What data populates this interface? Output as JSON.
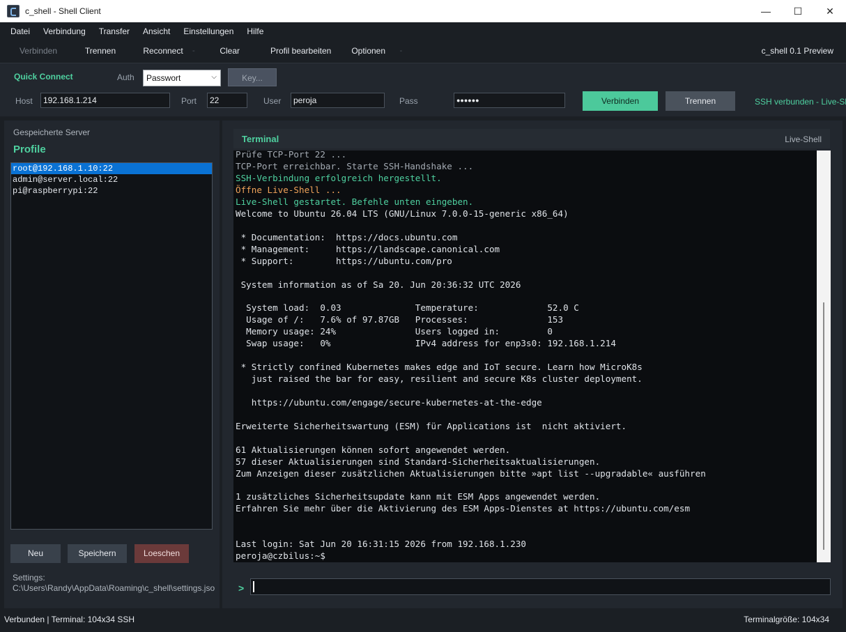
{
  "window": {
    "title": "c_shell - Shell Client",
    "controls": {
      "minimize": "—",
      "maximize": "☐",
      "close": "✕"
    }
  },
  "menu": [
    "Datei",
    "Verbindung",
    "Transfer",
    "Ansicht",
    "Einstellungen",
    "Hilfe"
  ],
  "toolbar": {
    "connect": "Verbinden",
    "disconnect": "Trennen",
    "reconnect": "Reconnect",
    "clear": "Clear",
    "edit_profile": "Profil bearbeiten",
    "options": "Optionen",
    "separator": "-",
    "version": "c_shell 0.1 Preview"
  },
  "quick_connect": {
    "title": "Quick Connect",
    "auth_label": "Auth",
    "auth_value": "Passwort",
    "key_button": "Key...",
    "host_label": "Host",
    "host_value": "192.168.1.214",
    "port_label": "Port",
    "port_value": "22",
    "user_label": "User",
    "user_value": "peroja",
    "pass_label": "Pass",
    "pass_value": "●●●●●●",
    "connect_button": "Verbinden",
    "disconnect_button": "Trennen",
    "status": "SSH verbunden - Live-Shell"
  },
  "sidebar": {
    "caption": "Gespeicherte Server",
    "title": "Profile",
    "profiles": [
      "root@192.168.1.10:22",
      "admin@server.local:22",
      "pi@raspberrypi:22"
    ],
    "selected_index": 0,
    "btn_new": "Neu",
    "btn_save": "Speichern",
    "btn_delete": "Loeschen",
    "settings_label": "Settings:",
    "settings_path": "C:\\Users\\Randy\\AppData\\Roaming\\c_shell\\settings.json"
  },
  "terminal": {
    "title": "Terminal",
    "badge": "Live-Shell",
    "lines": [
      {
        "text": "Prüfe TCP-Port 22 ...",
        "color": "gray"
      },
      {
        "text": "TCP-Port erreichbar. Starte SSH-Handshake ...",
        "color": "gray"
      },
      {
        "text": "SSH-Verbindung erfolgreich hergestellt.",
        "color": "green"
      },
      {
        "text": "Öffne Live-Shell ...",
        "color": "orange"
      },
      {
        "text": "Live-Shell gestartet. Befehle unten eingeben.",
        "color": "green"
      },
      {
        "text": "Welcome to Ubuntu 26.04 LTS (GNU/Linux 7.0.0-15-generic x86_64)",
        "color": "white"
      },
      {
        "text": "",
        "color": "white"
      },
      {
        "text": " * Documentation:  https://docs.ubuntu.com",
        "color": "white"
      },
      {
        "text": " * Management:     https://landscape.canonical.com",
        "color": "white"
      },
      {
        "text": " * Support:        https://ubuntu.com/pro",
        "color": "white"
      },
      {
        "text": "",
        "color": "white"
      },
      {
        "text": " System information as of Sa 20. Jun 20:36:32 UTC 2026",
        "color": "white"
      },
      {
        "text": "",
        "color": "white"
      },
      {
        "text": "  System load:  0.03              Temperature:             52.0 C",
        "color": "white"
      },
      {
        "text": "  Usage of /:   7.6% of 97.87GB   Processes:               153",
        "color": "white"
      },
      {
        "text": "  Memory usage: 24%               Users logged in:         0",
        "color": "white"
      },
      {
        "text": "  Swap usage:   0%                IPv4 address for enp3s0: 192.168.1.214",
        "color": "white"
      },
      {
        "text": "",
        "color": "white"
      },
      {
        "text": " * Strictly confined Kubernetes makes edge and IoT secure. Learn how MicroK8s",
        "color": "white"
      },
      {
        "text": "   just raised the bar for easy, resilient and secure K8s cluster deployment.",
        "color": "white"
      },
      {
        "text": "",
        "color": "white"
      },
      {
        "text": "   https://ubuntu.com/engage/secure-kubernetes-at-the-edge",
        "color": "white"
      },
      {
        "text": "",
        "color": "white"
      },
      {
        "text": "Erweiterte Sicherheitswartung (ESM) für Applications ist  nicht aktiviert.",
        "color": "white"
      },
      {
        "text": "",
        "color": "white"
      },
      {
        "text": "61 Aktualisierungen können sofort angewendet werden.",
        "color": "white"
      },
      {
        "text": "57 dieser Aktualisierungen sind Standard-Sicherheitsaktualisierungen.",
        "color": "white"
      },
      {
        "text": "Zum Anzeigen dieser zusätzlichen Aktualisierungen bitte »apt list --upgradable« ausführen",
        "color": "white"
      },
      {
        "text": "",
        "color": "white"
      },
      {
        "text": "1 zusätzliches Sicherheitsupdate kann mit ESM Apps angewendet werden.",
        "color": "white"
      },
      {
        "text": "Erfahren Sie mehr über die Aktivierung des ESM Apps-Dienstes at https://ubuntu.com/esm",
        "color": "white"
      },
      {
        "text": "",
        "color": "white"
      },
      {
        "text": "",
        "color": "white"
      },
      {
        "text": "Last login: Sat Jun 20 16:31:15 2026 from 192.168.1.230",
        "color": "white"
      },
      {
        "text": "peroja@czbilus:~$",
        "color": "white"
      }
    ],
    "prompt_symbol": ">",
    "command_value": ""
  },
  "statusbar": {
    "left": "Verbunden  |  Terminal: 104x34 SSH",
    "right": "Terminalgröße: 104x34"
  },
  "colors": {
    "accent": "#4fd1a0",
    "selection": "#0a72d4",
    "danger": "#6b3a3a",
    "warning": "#f0a35a"
  }
}
